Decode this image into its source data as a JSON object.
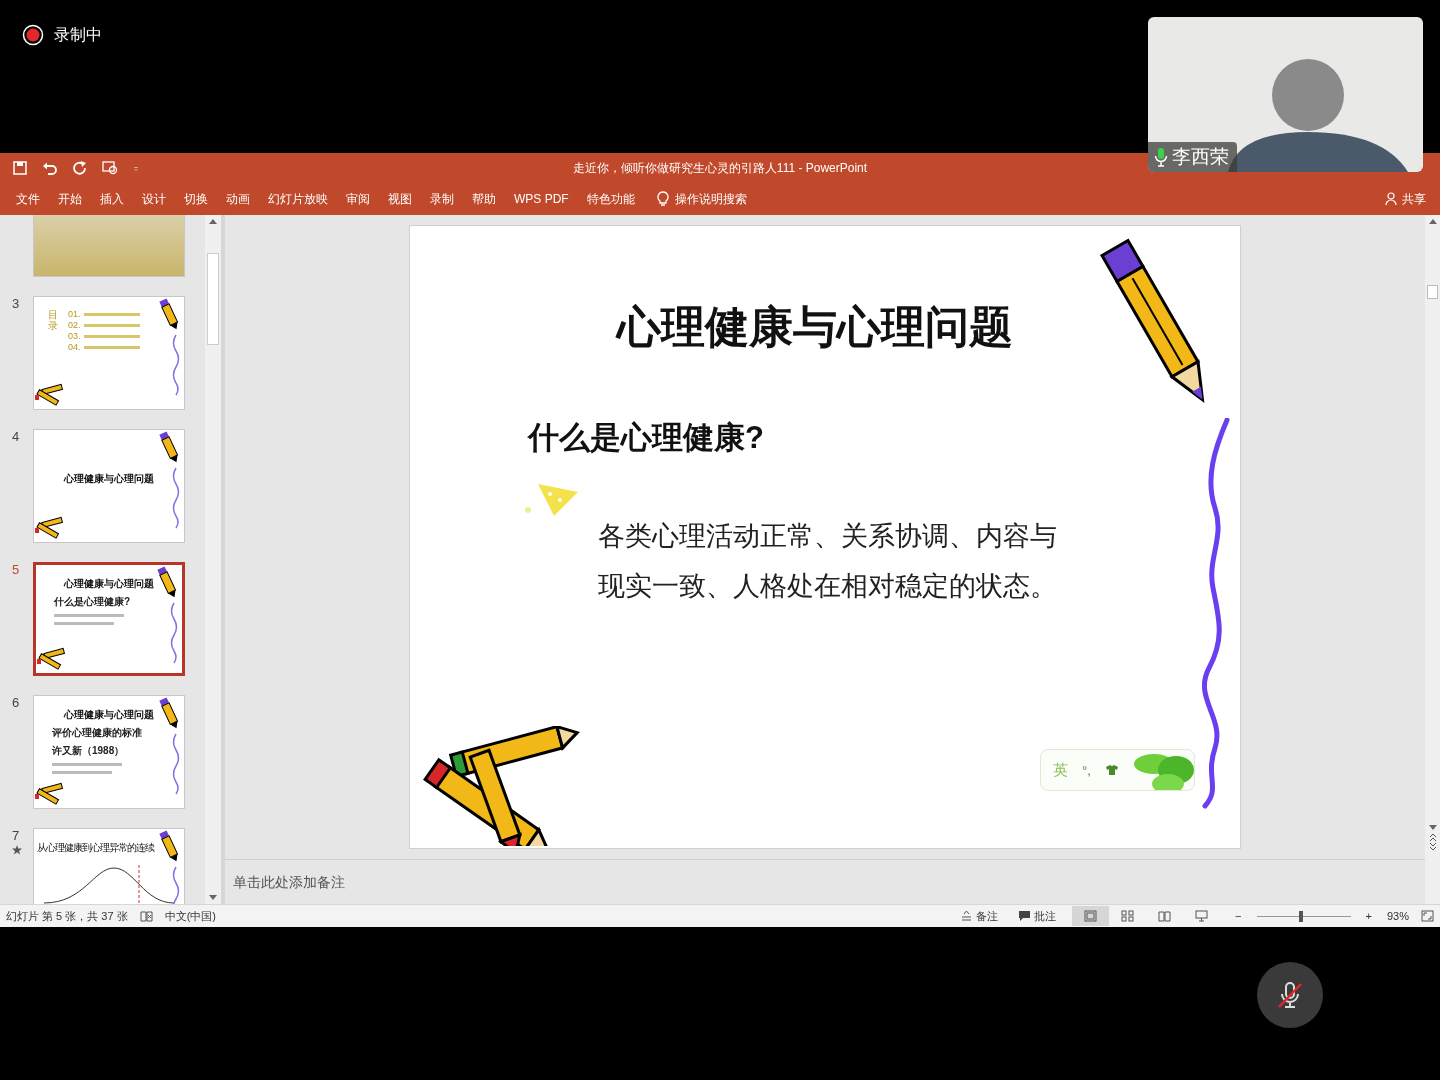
{
  "recording": {
    "label": "录制中"
  },
  "video": {
    "name": "李西荣"
  },
  "window": {
    "title": "走近你，倾听你做研究生心灵的引路人111  -  PowerPoint"
  },
  "ribbon_tabs": [
    {
      "label": "文件",
      "selected": false
    },
    {
      "label": "开始",
      "selected": false
    },
    {
      "label": "插入",
      "selected": false
    },
    {
      "label": "设计",
      "selected": false
    },
    {
      "label": "切换",
      "selected": false
    },
    {
      "label": "动画",
      "selected": false
    },
    {
      "label": "幻灯片放映",
      "selected": false
    },
    {
      "label": "审阅",
      "selected": false
    },
    {
      "label": "视图",
      "selected": false
    },
    {
      "label": "录制",
      "selected": false
    },
    {
      "label": "帮助",
      "selected": false
    },
    {
      "label": "WPS PDF",
      "selected": false
    },
    {
      "label": "特色功能",
      "selected": false
    }
  ],
  "tell_me": "操作说明搜索",
  "share": "共享",
  "thumbnails": [
    {
      "kind": "photo",
      "selected": false
    },
    {
      "kind": "toc",
      "number": "3",
      "selected": false,
      "heading": "目录",
      "items": [
        "01.",
        "02.",
        "03.",
        "04."
      ]
    },
    {
      "kind": "title",
      "number": "4",
      "selected": false,
      "title": "心理健康与心理问题"
    },
    {
      "kind": "content",
      "number": "5",
      "selected": true,
      "title": "心理健康与心理问题",
      "lines": [
        "什么是心理健康?"
      ]
    },
    {
      "kind": "content",
      "number": "6",
      "selected": false,
      "title": "心理健康与心理问题",
      "lines": [
        "评价心理健康的标准",
        "许又新（1988）"
      ]
    },
    {
      "kind": "chart",
      "number": "7",
      "selected": false,
      "animated": true,
      "title": "从心理健康到心理异常的连续"
    }
  ],
  "slide": {
    "title": "心理健康与心理问题",
    "subtitle": "什么是心理健康?",
    "body": [
      "各类心理活动正常、关系协调、内容与",
      "现实一致、人格处在相对稳定的状态。"
    ],
    "ime": {
      "mode": "英",
      "punct": "°,"
    }
  },
  "notes": {
    "placeholder": "单击此处添加备注"
  },
  "status_bar": {
    "slide_info": "幻灯片 第 5 张，共 37 张",
    "language": "中文(中国)",
    "notes": "备注",
    "comments": "批注",
    "views": [
      {
        "kind": "normal",
        "selected": true
      },
      {
        "kind": "sorter",
        "selected": false
      },
      {
        "kind": "reading",
        "selected": false
      },
      {
        "kind": "show",
        "selected": false
      }
    ],
    "zoom_out": "−",
    "zoom_in": "+",
    "zoom": {
      "level": 0.47,
      "reading": "93%"
    }
  }
}
